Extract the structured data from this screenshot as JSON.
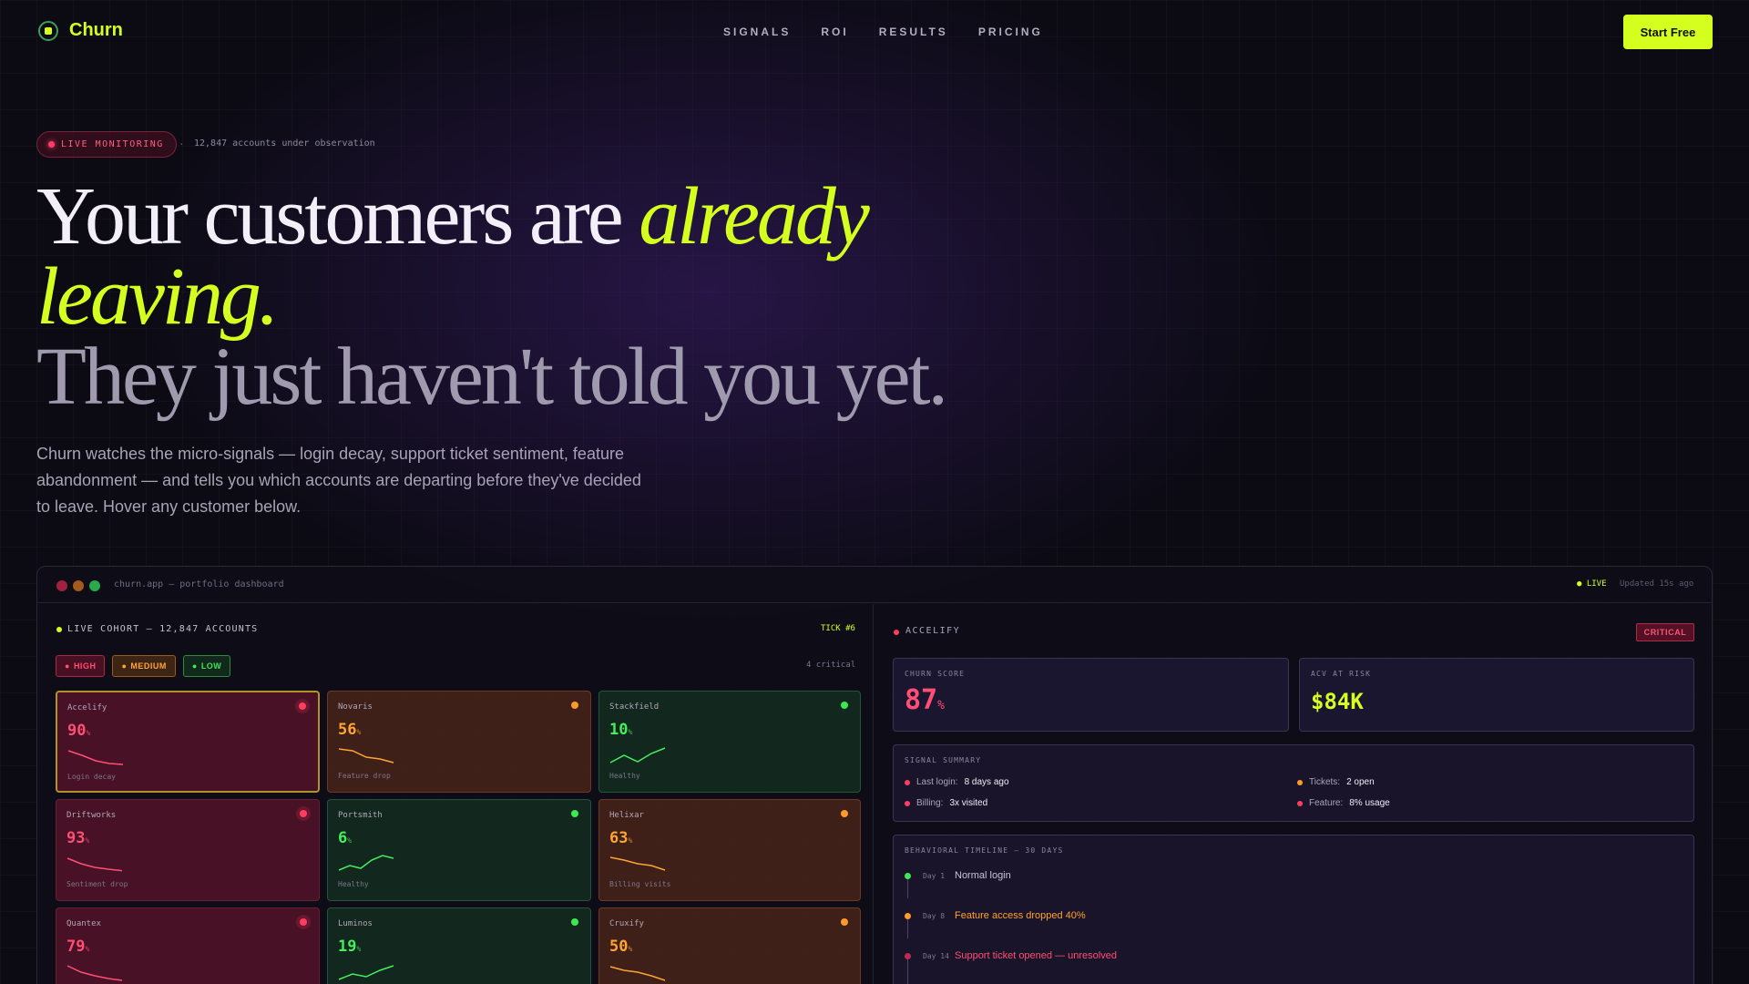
{
  "brand": {
    "name": "Churn"
  },
  "nav": {
    "links": [
      "SIGNALS",
      "ROI",
      "RESULTS",
      "PRICING"
    ],
    "cta": "Start Free"
  },
  "hero": {
    "pill": "LIVE MONITORING",
    "separator": "·",
    "accounts_note": "12,847 accounts under observation",
    "headline_part1": "Your customers are ",
    "headline_accent": "already leaving.",
    "headline_part2": "They just haven't told you yet.",
    "subtitle": "Churn watches the micro-signals — login decay, support ticket sentiment, feature abandonment — and tells you which accounts are departing before they've decided to leave. Hover any customer below."
  },
  "dashboard": {
    "window_title": "churn.app — portfolio dashboard",
    "live": "● LIVE",
    "updated": "Updated 15s ago",
    "cohort_title": "LIVE COHORT — 12,847 ACCOUNTS",
    "tick": "TICK #6",
    "filters": {
      "high": "HIGH",
      "medium": "MEDIUM",
      "low": "LOW"
    },
    "critical_count": "4 critical",
    "cards": [
      {
        "name": "Accelify",
        "score": "90",
        "unit": "%",
        "note": "Login decay",
        "risk": "high",
        "trend": [
          0.2,
          0.45,
          0.75,
          0.9,
          0.95
        ]
      },
      {
        "name": "Novaris",
        "score": "56",
        "unit": "%",
        "note": "Feature drop",
        "risk": "medium",
        "trend": [
          0.15,
          0.25,
          0.6,
          0.7,
          0.9
        ]
      },
      {
        "name": "Stackfield",
        "score": "10",
        "unit": "%",
        "note": "Healthy",
        "risk": "low",
        "trend": [
          0.9,
          0.5,
          0.85,
          0.4,
          0.1
        ]
      },
      {
        "name": "Driftworks",
        "score": "93",
        "unit": "%",
        "note": "Sentiment drop",
        "risk": "high",
        "trend": [
          0.2,
          0.5,
          0.7,
          0.8,
          0.88
        ]
      },
      {
        "name": "Portsmith",
        "score": "6",
        "unit": "%",
        "note": "Healthy",
        "risk": "low",
        "trend": [
          0.85,
          0.6,
          0.75,
          0.3,
          0.05,
          0.2
        ]
      },
      {
        "name": "Helixar",
        "score": "63",
        "unit": "%",
        "note": "Billing visits",
        "risk": "medium",
        "trend": [
          0.15,
          0.3,
          0.5,
          0.6,
          0.85
        ]
      },
      {
        "name": "Quantex",
        "score": "79",
        "unit": "%",
        "note": "",
        "risk": "high",
        "trend": [
          0.15,
          0.5,
          0.7,
          0.85,
          0.95
        ]
      },
      {
        "name": "Luminos",
        "score": "19",
        "unit": "%",
        "note": "",
        "risk": "low",
        "trend": [
          0.9,
          0.6,
          0.75,
          0.4,
          0.15
        ]
      },
      {
        "name": "Cruxify",
        "score": "50",
        "unit": "%",
        "note": "",
        "risk": "medium",
        "trend": [
          0.2,
          0.4,
          0.5,
          0.7,
          0.95
        ]
      }
    ],
    "detail": {
      "account": "ACCELIFY",
      "badge": "CRITICAL",
      "churn_label": "CHURN SCORE",
      "churn_score": "87",
      "churn_unit": "%",
      "acv_label": "ACV AT RISK",
      "acv": "$84K",
      "summary_label": "SIGNAL SUMMARY",
      "signals": [
        {
          "label": "Last login:",
          "value": "8 days ago",
          "color": "#ff3d5e"
        },
        {
          "label": "Tickets:",
          "value": "2 open",
          "color": "#ff9b2a"
        },
        {
          "label": "Billing:",
          "value": "3x visited",
          "color": "#ff3d5e"
        },
        {
          "label": "Feature:",
          "value": "8% usage",
          "color": "#ff3d5e"
        }
      ],
      "timeline_label": "BEHAVIORAL TIMELINE — 30 DAYS",
      "timeline": [
        {
          "day": "Day 1",
          "text": "Normal login",
          "color": "#3bea52",
          "text_color": "#c8c4d6"
        },
        {
          "day": "Day 8",
          "text": "Feature access dropped 40%",
          "color": "#ff9b2a",
          "text_color": "#ffa331"
        },
        {
          "day": "Day 14",
          "text": "Support ticket opened — unresolved",
          "color": "#c02a50",
          "text_color": "#ff4f74"
        }
      ]
    }
  },
  "colors": {
    "accent": "#d4ff1f",
    "high": "#ff4f74",
    "medium": "#ffa331",
    "low": "#45ee5c"
  }
}
